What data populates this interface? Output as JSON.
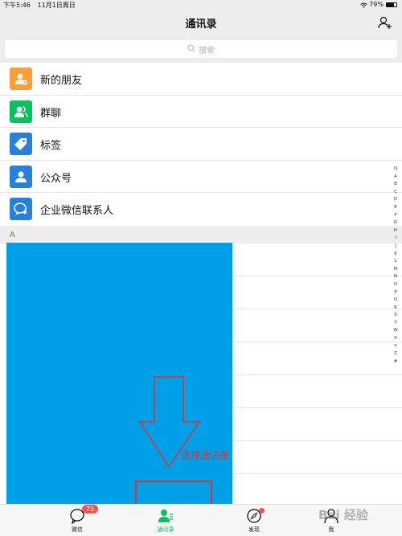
{
  "status_bar": {
    "time": "下午5:46",
    "date": "11月1日周日",
    "battery": "79%"
  },
  "nav": {
    "title": "通讯录",
    "add_icon": "add-contact-icon"
  },
  "search": {
    "placeholder": "搜索",
    "icon": "search-icon"
  },
  "func_items": [
    {
      "label": "新的朋友",
      "color": "#fa9d3b",
      "icon": "new-friend-icon"
    },
    {
      "label": "群聊",
      "color": "#07c160",
      "icon": "group-chat-icon"
    },
    {
      "label": "标签",
      "color": "#2782d7",
      "icon": "tag-icon"
    },
    {
      "label": "公众号",
      "color": "#2782d7",
      "icon": "official-account-icon"
    },
    {
      "label": "企业微信联系人",
      "color": "#2782d7",
      "icon": "wecom-icon"
    }
  ],
  "section_letter": "A",
  "index_letters": [
    "Q",
    "A",
    "B",
    "C",
    "D",
    "E",
    "F",
    "G",
    "H",
    "I",
    "J",
    "K",
    "L",
    "M",
    "N",
    "O",
    "P",
    "Q",
    "R",
    "S",
    "T",
    "W",
    "X",
    "Y",
    "Z",
    "#"
  ],
  "annotation": {
    "text": "选择通讯录",
    "color": "#e03030"
  },
  "tabs": [
    {
      "label": "微信",
      "icon": "chat-icon",
      "badge": "75"
    },
    {
      "label": "通讯录",
      "icon": "contacts-icon",
      "active": true
    },
    {
      "label": "发现",
      "icon": "discover-icon"
    },
    {
      "label": "我",
      "icon": "me-icon"
    }
  ],
  "colors": {
    "accent": "#07c160",
    "badge": "#fa5151",
    "overlay_block": "#00a0e9"
  },
  "watermark": "Bai 经验"
}
